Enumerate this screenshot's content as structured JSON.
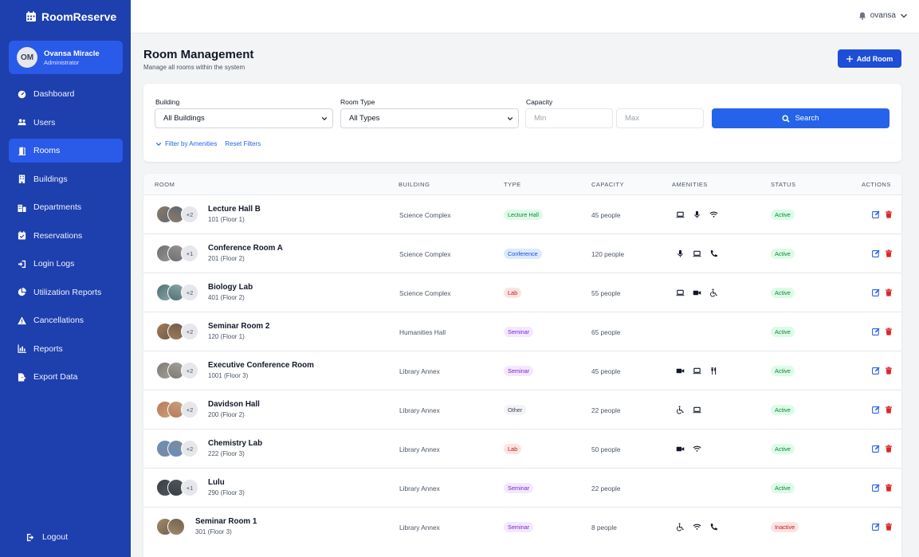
{
  "app": {
    "name": "RoomReserve"
  },
  "user": {
    "initials": "OM",
    "name": "Ovansa Miracle",
    "role": "Administrator",
    "topbar_name": "ovansa"
  },
  "nav": [
    {
      "label": "Dashboard",
      "icon": "dashboard-icon"
    },
    {
      "label": "Users",
      "icon": "users-icon"
    },
    {
      "label": "Rooms",
      "icon": "door-icon",
      "active": true
    },
    {
      "label": "Buildings",
      "icon": "building-icon"
    },
    {
      "label": "Departments",
      "icon": "departments-icon"
    },
    {
      "label": "Reservations",
      "icon": "calendar-check-icon"
    },
    {
      "label": "Login Logs",
      "icon": "sign-in-icon"
    },
    {
      "label": "Utilization Reports",
      "icon": "pie-chart-icon"
    },
    {
      "label": "Cancellations",
      "icon": "warning-icon"
    },
    {
      "label": "Reports",
      "icon": "bar-chart-icon"
    },
    {
      "label": "Export Data",
      "icon": "export-file-icon"
    }
  ],
  "logout_label": "Logout",
  "page": {
    "title": "Room Management",
    "subtitle": "Manage all rooms within the system",
    "add_button": "Add Room"
  },
  "filters": {
    "building_label": "Building",
    "building_value": "All Buildings",
    "type_label": "Room Type",
    "type_value": "All Types",
    "capacity_label": "Capacity",
    "min_placeholder": "Min",
    "max_placeholder": "Max",
    "search_button": "Search",
    "amenities_link": "Filter by Amenities",
    "reset_link": "Reset Filters"
  },
  "table": {
    "headers": {
      "room": "ROOM",
      "building": "BUILDING",
      "type": "TYPE",
      "capacity": "CAPACITY",
      "amenities": "AMENITIES",
      "status": "STATUS",
      "actions": "ACTIONS"
    },
    "rows": [
      {
        "name": "Lecture Hall B",
        "sub": "101 (Floor 1)",
        "more": "+2",
        "building": "Science Complex",
        "type": "Lecture Hall",
        "type_key": "lecture",
        "capacity": "45 people",
        "amenities": [
          "laptop-icon",
          "microphone-icon",
          "wifi-icon"
        ],
        "status": "Active"
      },
      {
        "name": "Conference Room A",
        "sub": "201 (Floor 2)",
        "more": "+1",
        "building": "Science Complex",
        "type": "Conference",
        "type_key": "conference",
        "capacity": "120 people",
        "amenities": [
          "microphone-icon",
          "laptop-icon",
          "phone-icon"
        ],
        "status": "Active"
      },
      {
        "name": "Biology Lab",
        "sub": "401 (Floor 2)",
        "more": "+2",
        "building": "Science Complex",
        "type": "Lab",
        "type_key": "lab",
        "capacity": "55 people",
        "amenities": [
          "laptop-icon",
          "video-camera-icon",
          "wheelchair-icon"
        ],
        "status": "Active"
      },
      {
        "name": "Seminar Room 2",
        "sub": "120 (Floor 1)",
        "more": "+2",
        "building": "Humanities Hall",
        "type": "Seminar",
        "type_key": "seminar",
        "capacity": "65 people",
        "amenities": [],
        "status": "Active"
      },
      {
        "name": "Executive Conference Room",
        "sub": "1001 (Floor 3)",
        "more": "+2",
        "building": "Library Annex",
        "type": "Seminar",
        "type_key": "seminar",
        "capacity": "45 people",
        "amenities": [
          "video-camera-icon",
          "laptop-icon",
          "utensils-icon"
        ],
        "status": "Active"
      },
      {
        "name": "Davidson Hall",
        "sub": "200 (Floor 2)",
        "more": "+2",
        "building": "Library Annex",
        "type": "Other",
        "type_key": "other",
        "capacity": "22 people",
        "amenities": [
          "wheelchair-icon",
          "laptop-icon"
        ],
        "status": "Active"
      },
      {
        "name": "Chemistry Lab",
        "sub": "222 (Floor 3)",
        "more": "+2",
        "building": "Library Annex",
        "type": "Lab",
        "type_key": "lab",
        "capacity": "50 people",
        "amenities": [
          "video-camera-icon",
          "wifi-icon"
        ],
        "status": "Active"
      },
      {
        "name": "Lulu",
        "sub": "290 (Floor 3)",
        "more": "+1",
        "building": "Library Annex",
        "type": "Seminar",
        "type_key": "seminar",
        "capacity": "22 people",
        "amenities": [],
        "status": "Active"
      },
      {
        "name": "Seminar Room 1",
        "sub": "301 (Floor 3)",
        "more": "",
        "building": "Library Annex",
        "type": "Seminar",
        "type_key": "seminar",
        "capacity": "8 people",
        "amenities": [
          "wheelchair-icon",
          "wifi-icon",
          "phone-icon"
        ],
        "status": "Inactive"
      }
    ]
  },
  "colors": {
    "sidebar": "#1e3fae",
    "accent": "#2563eb",
    "badge_lecture_bg": "#dcfce7",
    "badge_lecture_fg": "#15803d",
    "badge_conference_bg": "#dbeafe",
    "badge_conference_fg": "#1d4ed8",
    "badge_lab_bg": "#fee2e2",
    "badge_lab_fg": "#b91c1c",
    "badge_seminar_bg": "#f3e8ff",
    "badge_seminar_fg": "#7e22ce",
    "badge_other_bg": "#f3f4f6",
    "badge_other_fg": "#374151",
    "status_active_bg": "#dcfce7",
    "status_active_fg": "#15803d",
    "status_inactive_bg": "#fee2e2",
    "status_inactive_fg": "#b91c1c"
  }
}
